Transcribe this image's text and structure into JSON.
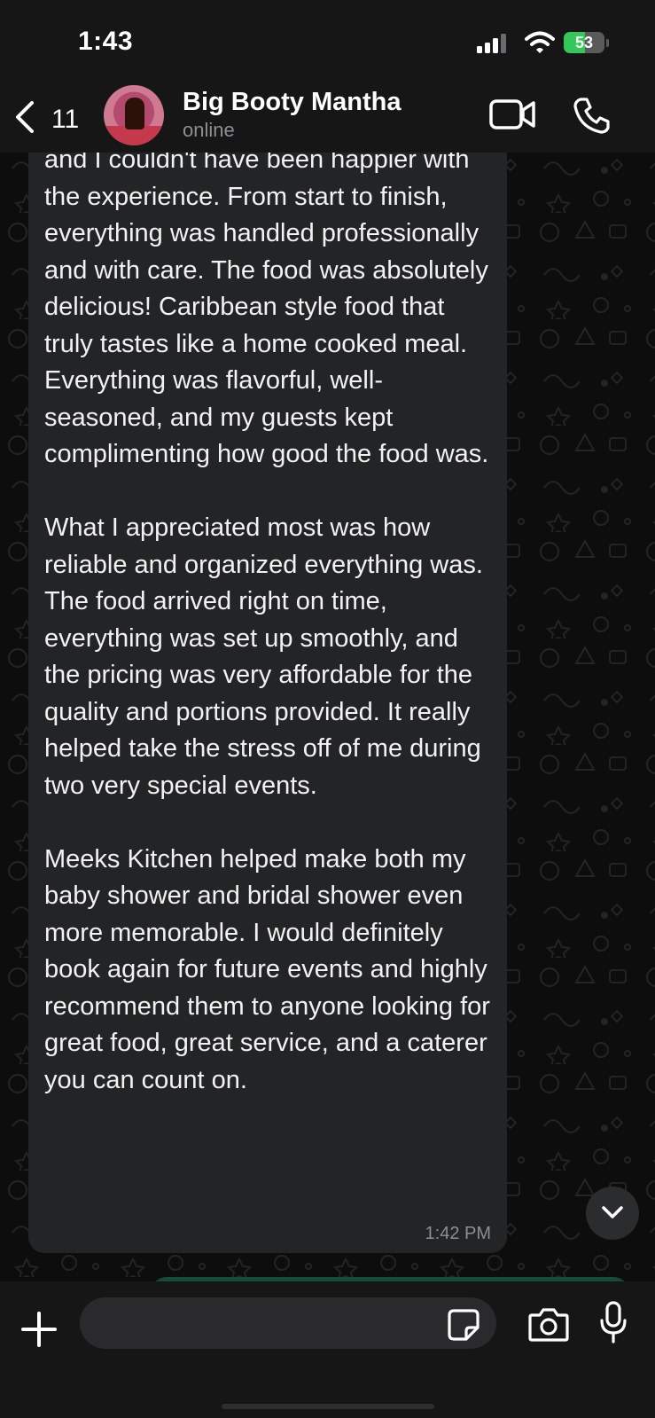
{
  "status_bar": {
    "time": "1:43",
    "battery_percent": "53",
    "battery_level": 0.53,
    "battery_color": "#35c759"
  },
  "header": {
    "back_count": "11",
    "contact_name": "Big Booty Mantha",
    "contact_status": "online",
    "icons": [
      "chevron-left-icon",
      "video-camera-icon",
      "phone-icon"
    ]
  },
  "message": {
    "text": "and I couldn't have been happier with the experience. From start to finish, everything was handled professionally and with care. The food was absolutely delicious! Caribbean style food that truly tastes like a home cooked meal. Everything was flavorful, well-seasoned, and my guests kept complimenting how good the food was.\n\nWhat I appreciated most was how reliable and organized everything was. The food arrived right on time, everything was set up smoothly, and the pricing was very affordable for the quality and portions provided. It really helped take the stress off of me during two very special events.\n\nMeeks Kitchen helped make both my baby shower and bridal shower even more memorable. I would definitely book again for future events and highly recommend them to anyone looking for great food, great service, and a caterer you can count on.",
    "time": "1:42 PM",
    "bubble_color": "#232425"
  },
  "input_bar": {
    "placeholder": "",
    "icons": [
      "plus-icon",
      "sticker-icon",
      "camera-icon",
      "microphone-icon"
    ]
  },
  "colors": {
    "background": "#0d0d0d",
    "bar_background": "#161617",
    "outgoing_bubble": "#144d37"
  }
}
